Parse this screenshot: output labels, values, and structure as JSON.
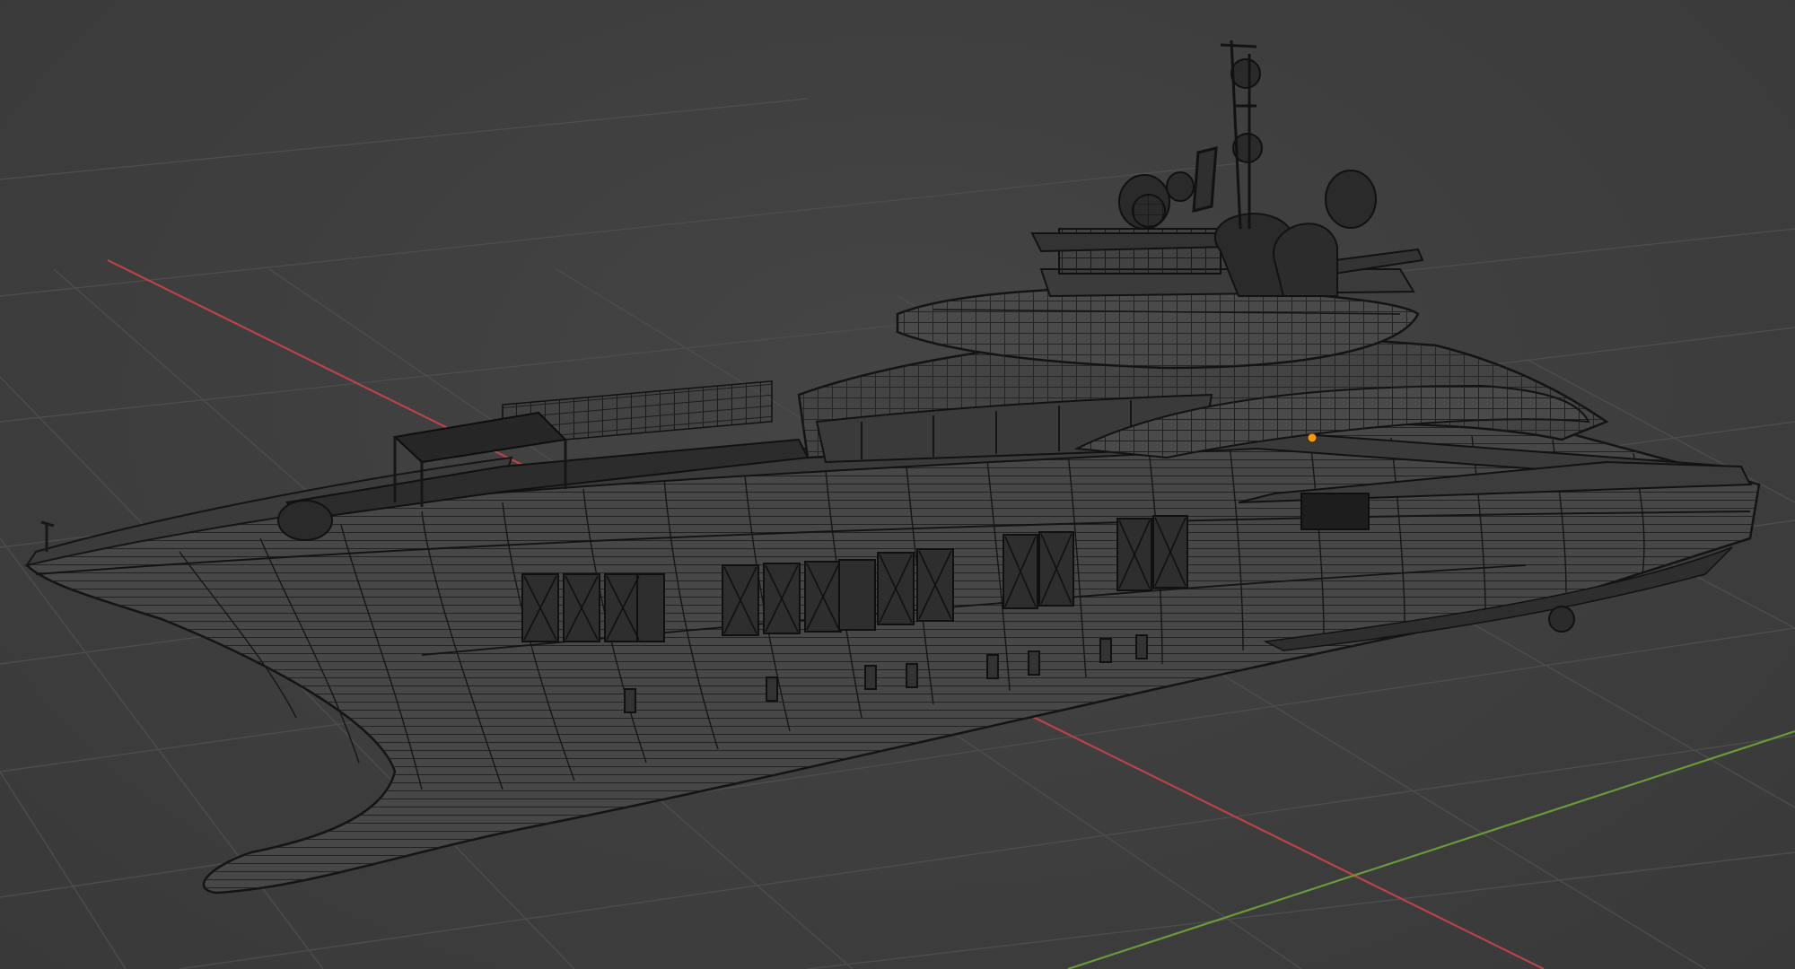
{
  "viewport": {
    "mode": "3D viewport",
    "shading": "wireframe",
    "object": "yacht-model",
    "axes": {
      "x_color": "#c83c44",
      "y_color": "#6fa03a"
    },
    "grid_color": "#4c4c4c",
    "wire_color": "#1a1a1a",
    "hull_fill": "#464646",
    "origin_color": "#f0901a"
  }
}
